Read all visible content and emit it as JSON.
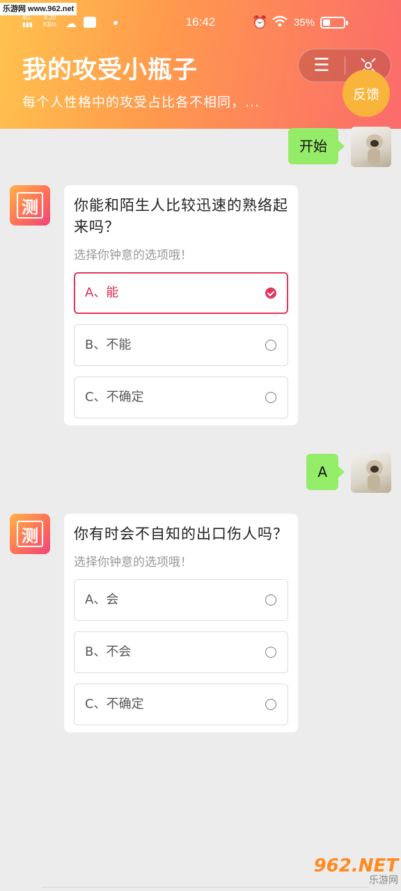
{
  "watermark_top": "乐游网 www.962.net",
  "status_bar": {
    "network": "4G",
    "speed": "4.20",
    "speed_unit": "KB/s",
    "time": "16:42",
    "battery_percent": "35%",
    "battery_level": 0.35
  },
  "header": {
    "title": "我的攻受小瓶子",
    "subtitle": "每个人性格中的攻受占比各不相同，...",
    "menu_icon": "menu-icon",
    "close_icon": "close-icon",
    "feedback_label": "反馈"
  },
  "bot": {
    "avatar_char": "测"
  },
  "messages": {
    "user_1": "开始",
    "q1": {
      "question": "你能和陌生人比较迅速的熟络起来吗？",
      "hint": "选择你钟意的选项哦！",
      "options": [
        "A、能",
        "B、不能",
        "C、不确定"
      ],
      "selected_index": 0
    },
    "user_2": "A",
    "q2": {
      "question": "你有时会不自知的出口伤人吗？",
      "hint": "选择你钟意的选项哦！",
      "options": [
        "A、会",
        "B、不会",
        "C、不确定"
      ],
      "selected_index": null
    }
  },
  "watermark_bottom": {
    "logo": "962.NET",
    "sub": "乐游网"
  },
  "colors": {
    "header_start": "#ffc34d",
    "header_end": "#fb6b6b",
    "user_bubble": "#95ec69",
    "selected": "#e3365c",
    "feedback": "#f9b53b"
  }
}
